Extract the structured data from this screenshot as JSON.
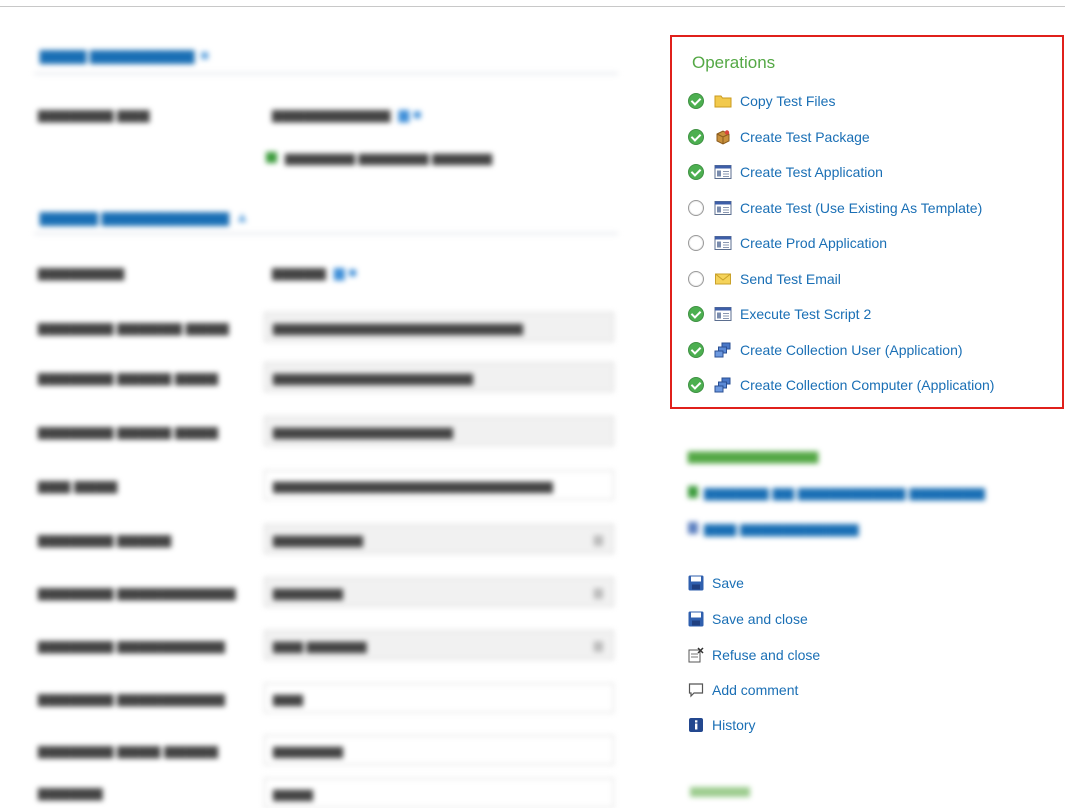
{
  "operations": {
    "title": "Operations",
    "items": [
      {
        "label": "Copy Test Files",
        "status": "done",
        "icon": "folder-icon"
      },
      {
        "label": "Create Test Package",
        "status": "done",
        "icon": "package-icon"
      },
      {
        "label": "Create Test Application",
        "status": "done",
        "icon": "application-icon"
      },
      {
        "label": "Create Test (Use Existing As Template)",
        "status": "pending",
        "icon": "application-icon"
      },
      {
        "label": "Create Prod Application",
        "status": "pending",
        "icon": "application-icon"
      },
      {
        "label": "Send Test Email",
        "status": "pending",
        "icon": "envelope-icon"
      },
      {
        "label": "Execute Test Script 2",
        "status": "done",
        "icon": "application-icon"
      },
      {
        "label": "Create Collection User (Application)",
        "status": "done",
        "icon": "computers-icon"
      },
      {
        "label": "Create Collection Computer (Application)",
        "status": "done",
        "icon": "computers-icon"
      }
    ]
  },
  "actions": {
    "save": "Save",
    "save_and_close": "Save and close",
    "refuse_and_close": "Refuse and close",
    "add_comment": "Add comment",
    "history": "History"
  },
  "colors": {
    "accent_link": "#1a6fb5",
    "title_green": "#54a845",
    "highlight_border": "#e0201b",
    "status_done": "#4caf50"
  }
}
